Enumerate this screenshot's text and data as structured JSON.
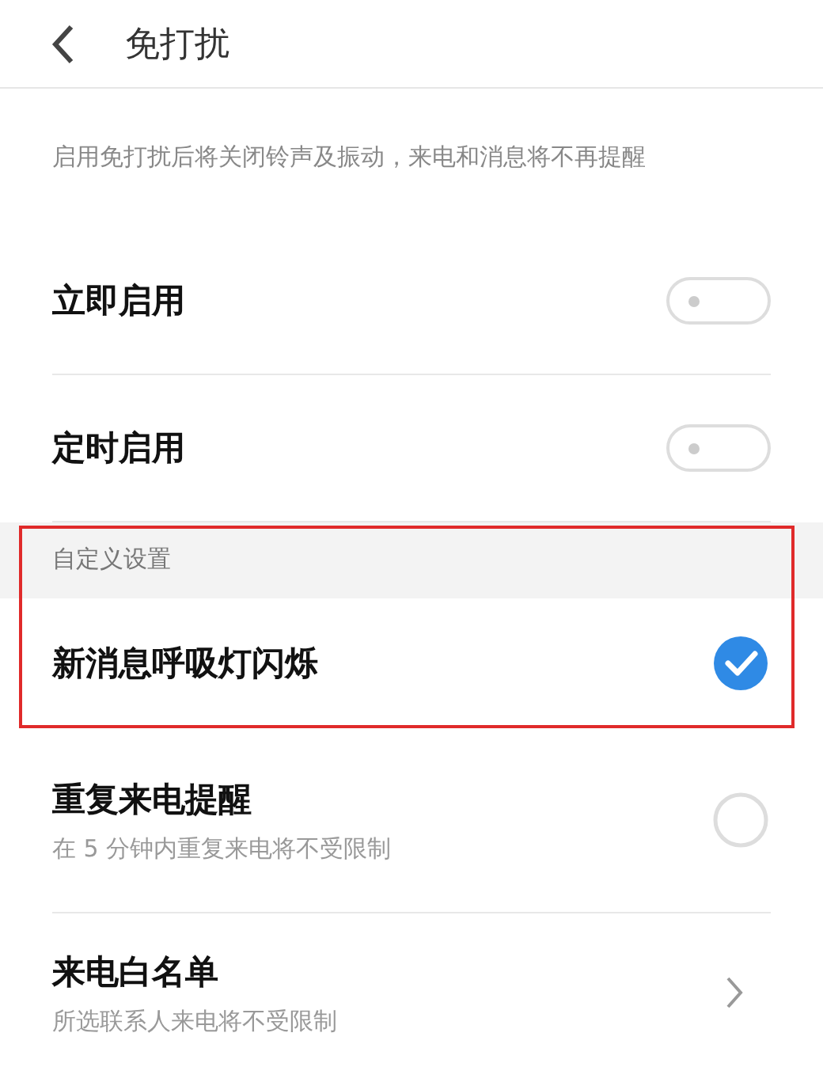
{
  "header": {
    "title": "免打扰"
  },
  "description": "启用免打扰后将关闭铃声及振动，来电和消息将不再提醒",
  "items": [
    {
      "kind": "switch",
      "label": "立即启用",
      "on": false
    },
    {
      "kind": "switch",
      "label": "定时启用",
      "on": false
    }
  ],
  "custom_section": {
    "title": "自定义设置",
    "highlighted": true,
    "items": [
      {
        "kind": "check",
        "label": "新消息呼吸灯闪烁",
        "checked": true,
        "highlighted": true
      },
      {
        "kind": "check",
        "label": "重复来电提醒",
        "subtitle": "在 5 分钟内重复来电将不受限制",
        "checked": false,
        "highlighted": false
      },
      {
        "kind": "link",
        "label": "来电白名单",
        "subtitle": "所选联系人来电将不受限制",
        "highlighted": false
      }
    ]
  }
}
